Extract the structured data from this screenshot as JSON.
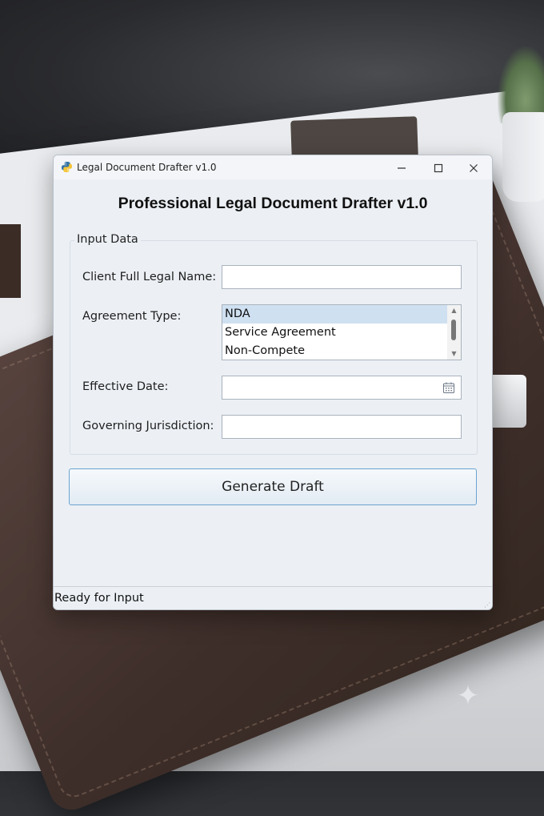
{
  "window": {
    "title": "Legal Document Drafter v1.0",
    "icon": "python-icon",
    "controls": {
      "minimize": "minimize-icon",
      "maximize": "maximize-icon",
      "close": "close-icon"
    }
  },
  "app": {
    "heading": "Professional Legal Document Drafter v1.0"
  },
  "input_group": {
    "legend": "Input Data",
    "client_name": {
      "label": "Client Full Legal Name:",
      "value": ""
    },
    "agreement_type": {
      "label": "Agreement Type:",
      "options": [
        "NDA",
        "Service Agreement",
        "Non-Compete"
      ],
      "selected": "NDA"
    },
    "effective_date": {
      "label": "Effective Date:",
      "value": "",
      "icon": "calendar-icon"
    },
    "jurisdiction": {
      "label": "Governing Jurisdiction:",
      "value": ""
    }
  },
  "actions": {
    "generate_label": "Generate Draft"
  },
  "status": {
    "text": "Ready for Input"
  },
  "colors": {
    "window_bg": "#ecf0f5",
    "selection": "#cfe0f1",
    "button_border": "#6aa3cf"
  }
}
